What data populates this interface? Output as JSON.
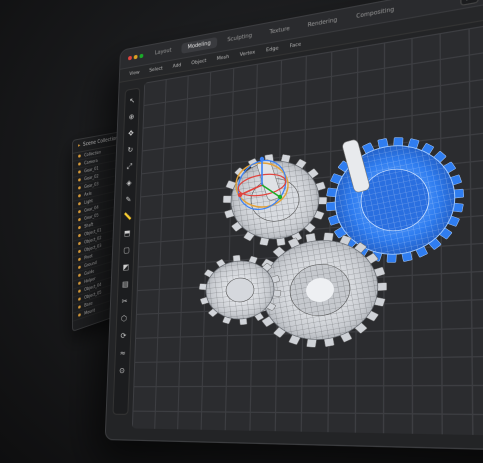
{
  "outliner": {
    "title": "Scene Collection",
    "rows": [
      "Collection",
      "Camera",
      "Gear_01",
      "Gear_02",
      "Gear_03",
      "Axle",
      "Light",
      "Gear_04",
      "Gear_05",
      "Shaft",
      "Object_01",
      "Object_02",
      "Object_03",
      "Pivot",
      "Ground",
      "Guide",
      "Helper",
      "Object_04",
      "Object_05",
      "Base",
      "Mount"
    ]
  },
  "window": {
    "tabs": [
      "Layout",
      "Modeling",
      "Sculpting",
      "Texture",
      "Rendering",
      "Compositing"
    ],
    "active_tab": "Modeling",
    "menu": [
      "View",
      "Select",
      "Add",
      "Object",
      "Mesh",
      "Vertex",
      "Edge",
      "Face"
    ],
    "colors": {
      "accent": "#3b82f6",
      "gear_blue": "#2f7df0",
      "gear_white": "#e6e8ec",
      "traffic_red": "#e0443e",
      "traffic_yellow": "#dea123",
      "traffic_green": "#1aab29"
    }
  }
}
